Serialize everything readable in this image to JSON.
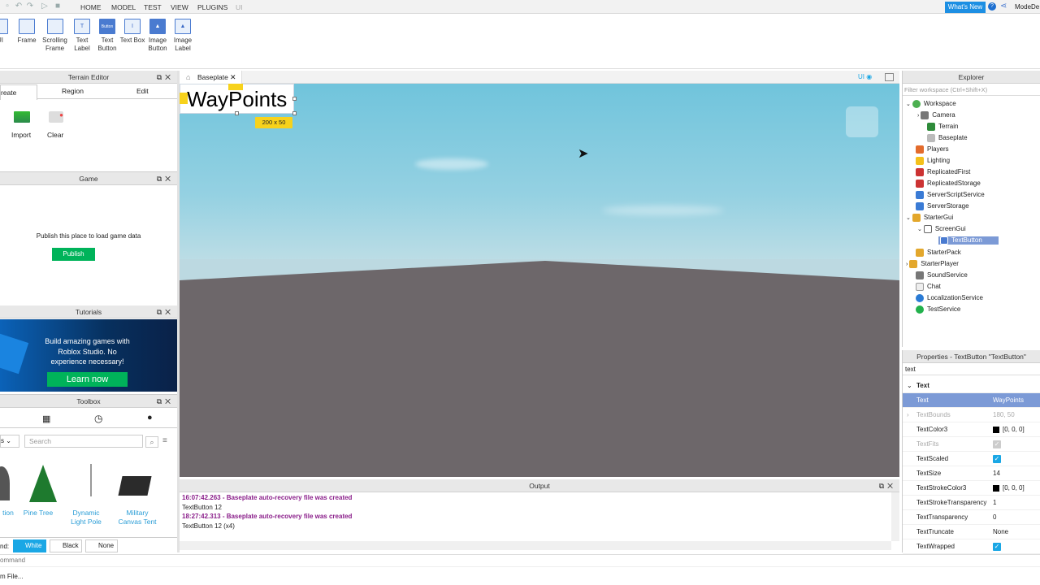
{
  "menu": {
    "items": [
      "HOME",
      "MODEL",
      "TEST",
      "VIEW",
      "PLUGINS",
      "UI"
    ],
    "whats_new": "What's New",
    "account": "ModeDe"
  },
  "ribbon": {
    "tools": [
      {
        "label": "UI",
        "glyph": ""
      },
      {
        "label": "Frame",
        "glyph": ""
      },
      {
        "label": "Scrolling Frame",
        "glyph": ""
      },
      {
        "label": "Text Label",
        "glyph": "T"
      },
      {
        "label": "Text Button",
        "glyph": "Button"
      },
      {
        "label": "Text Box",
        "glyph": "I"
      },
      {
        "label": "Image Button",
        "glyph": "▲"
      },
      {
        "label": "Image Label",
        "glyph": "▲"
      }
    ]
  },
  "terrain": {
    "title": "Terrain Editor",
    "tabs": [
      "reate",
      "Region",
      "Edit"
    ],
    "actions": [
      "Import",
      "Clear"
    ]
  },
  "game": {
    "title": "Game",
    "message": "Publish this place to load game data",
    "publish": "Publish"
  },
  "tutorials": {
    "title": "Tutorials",
    "text": "Build amazing games with Roblox Studio. No experience necessary!",
    "cta": "Learn now"
  },
  "toolbox": {
    "title": "Toolbox",
    "dropdown": "s",
    "search_placeholder": "Search",
    "items": [
      "tion",
      "Pine Tree",
      "Dynamic Light Pole",
      "Military Canvas Tent"
    ],
    "bg_label": "nd:",
    "bg_options": [
      "White",
      "Black",
      "None"
    ]
  },
  "doc": {
    "tab": "Baseplate",
    "ui_toggle": "UI",
    "gui_text": "WayPoints",
    "size_badge": "200 x 50"
  },
  "explorer": {
    "title": "Explorer",
    "filter_placeholder": "Filter workspace (Ctrl+Shift+X)",
    "items": [
      "Workspace",
      "Camera",
      "Terrain",
      "Baseplate",
      "Players",
      "Lighting",
      "ReplicatedFirst",
      "ReplicatedStorage",
      "ServerScriptService",
      "ServerStorage",
      "StarterGui",
      "ScreenGui",
      "TextButton",
      "StarterPack",
      "StarterPlayer",
      "SoundService",
      "Chat",
      "LocalizationService",
      "TestService"
    ]
  },
  "properties": {
    "title": "Properties - TextButton \"TextButton\"",
    "filter": "text",
    "section": "Text",
    "rows": [
      {
        "k": "Text",
        "v": "WayPoints"
      },
      {
        "k": "TextBounds",
        "v": "180, 50"
      },
      {
        "k": "TextColor3",
        "v": "[0, 0, 0]"
      },
      {
        "k": "TextFits",
        "v": ""
      },
      {
        "k": "TextScaled",
        "v": ""
      },
      {
        "k": "TextSize",
        "v": "14"
      },
      {
        "k": "TextStrokeColor3",
        "v": "[0, 0, 0]"
      },
      {
        "k": "TextStrokeTransparency",
        "v": "1"
      },
      {
        "k": "TextTransparency",
        "v": "0"
      },
      {
        "k": "TextTruncate",
        "v": "None"
      },
      {
        "k": "TextWrapped",
        "v": ""
      }
    ]
  },
  "output": {
    "title": "Output",
    "lines": [
      "16:07:42.263 - Baseplate auto-recovery file was created",
      "TextButton 12",
      "18:27:42.313 - Baseplate auto-recovery file was created",
      "TextButton 12 (x4)"
    ]
  },
  "status": {
    "command": "ommand",
    "left_text": "m File..."
  }
}
